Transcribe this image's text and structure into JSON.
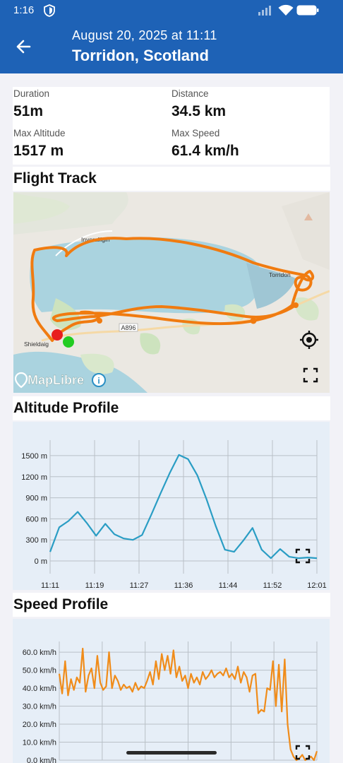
{
  "status_bar": {
    "time": "1:16"
  },
  "header": {
    "date": "August 20, 2025 at 11:11",
    "location": "Torridon, Scotland"
  },
  "stats": {
    "duration_label": "Duration",
    "duration": "51m",
    "distance_label": "Distance",
    "distance": "34.5 km",
    "max_altitude_label": "Max Altitude",
    "max_altitude": "1517 m",
    "max_speed_label": "Max Speed",
    "max_speed": "61.4 km/h"
  },
  "sections": {
    "flight_track": "Flight Track",
    "altitude_profile": "Altitude Profile",
    "speed_profile": "Speed Profile"
  },
  "map": {
    "labels": {
      "town_north": "Inveralligin",
      "town_east": "Torridon",
      "town_west": "Shieldaig",
      "road": "A896"
    },
    "attribution": "MapLibre",
    "track_color": "#f07b10"
  },
  "chart_data": [
    {
      "type": "line",
      "title": "Altitude Profile",
      "x": [
        "11:11",
        "11:13",
        "11:15",
        "11:16",
        "11:17",
        "11:19",
        "11:20",
        "11:22",
        "11:24",
        "11:26",
        "11:28",
        "11:30",
        "11:32",
        "11:34",
        "11:35",
        "11:36",
        "11:37",
        "11:39",
        "11:41",
        "11:43",
        "11:44",
        "11:46",
        "11:48",
        "11:50",
        "11:51",
        "11:52",
        "11:54",
        "11:56",
        "11:58",
        "12:01"
      ],
      "series": [
        {
          "values": [
            130,
            480,
            570,
            700,
            540,
            360,
            530,
            380,
            320,
            300,
            370,
            660,
            960,
            1250,
            1510,
            1450,
            1220,
            880,
            500,
            160,
            130,
            290,
            470,
            160,
            40,
            170,
            60,
            40,
            50,
            40
          ]
        }
      ],
      "x_ticks": [
        "11:11",
        "11:19",
        "11:27",
        "11:36",
        "11:44",
        "11:52",
        "12:01"
      ],
      "y_ticks": [
        "0 m",
        "300 m",
        "600 m",
        "900 m",
        "1200 m",
        "1500 m"
      ],
      "ylim": [
        -80,
        1620
      ],
      "color": "#2a9dc4",
      "grid": true
    },
    {
      "type": "line",
      "title": "Speed Profile",
      "y_ticks": [
        "0.0 km/h",
        "10.0 km/h",
        "20.0 km/h",
        "30.0 km/h",
        "40.0 km/h",
        "50.0 km/h",
        "60.0 km/h"
      ],
      "ylim": [
        0,
        62
      ],
      "series": [
        {
          "values": [
            48,
            37,
            55,
            36,
            45,
            39,
            46,
            43,
            62,
            38,
            47,
            51,
            40,
            58,
            43,
            39,
            41,
            60,
            40,
            47,
            44,
            39,
            42,
            40,
            41,
            38,
            43,
            39,
            41,
            40,
            44,
            49,
            42,
            55,
            45,
            59,
            50,
            58,
            48,
            61,
            46,
            52,
            44,
            47,
            40,
            48,
            43,
            46,
            42,
            49,
            45,
            47,
            50,
            46,
            48,
            49,
            47,
            51,
            46,
            48,
            45,
            52,
            43,
            49,
            46,
            38,
            47,
            48,
            26,
            28,
            27,
            40,
            39,
            55,
            30,
            53,
            27,
            56,
            20,
            6,
            2,
            0,
            1,
            3,
            0,
            1,
            2,
            0,
            5
          ]
        }
      ],
      "color": "#f08c1a",
      "grid": true
    }
  ]
}
